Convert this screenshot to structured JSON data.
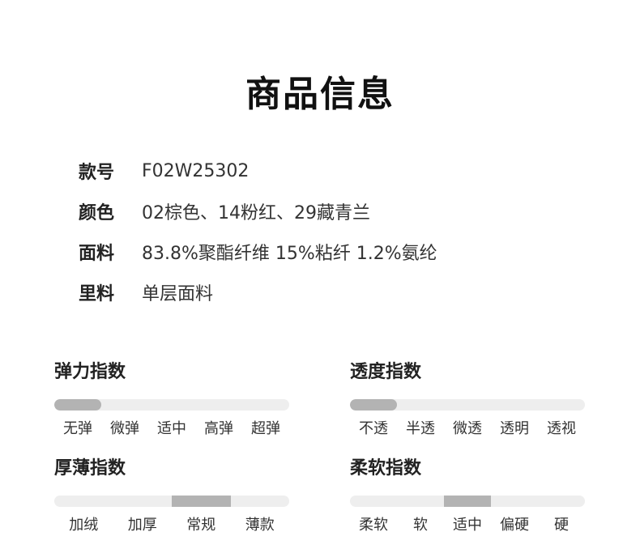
{
  "title": "商品信息",
  "info": [
    {
      "label": "款号",
      "value": "F02W25302"
    },
    {
      "label": "颜色",
      "value": "02棕色、14粉红、29藏青兰"
    },
    {
      "label": "面料",
      "value": "83.8%聚酯纤维 15%粘纤 1.2%氨纶"
    },
    {
      "label": "里料",
      "value": "单层面料"
    }
  ],
  "meters": {
    "elasticity": {
      "title": "弹力指数",
      "levels": [
        "无弹",
        "微弹",
        "适中",
        "高弹",
        "超弹"
      ],
      "selected": "无弹",
      "selected_index": 0
    },
    "transparency": {
      "title": "透度指数",
      "levels": [
        "不透",
        "半透",
        "微透",
        "透明",
        "透视"
      ],
      "selected": "不透",
      "selected_index": 0
    },
    "thickness": {
      "title": "厚薄指数",
      "levels": [
        "加绒",
        "加厚",
        "常规",
        "薄款"
      ],
      "selected": "常规",
      "selected_index": 2
    },
    "softness": {
      "title": "柔软指数",
      "levels": [
        "柔软",
        "软",
        "适中",
        "偏硬",
        "硬"
      ],
      "selected": "适中",
      "selected_index": 2
    }
  },
  "colors": {
    "track": "#eeeeee",
    "fill": "#b3b3b3"
  }
}
